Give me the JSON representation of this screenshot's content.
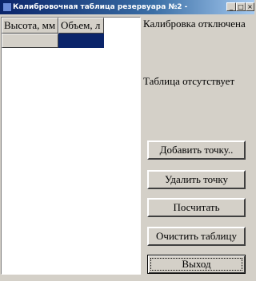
{
  "window": {
    "title": "Калибровочная таблица резервуара №2 -",
    "controls": {
      "minimize": "_",
      "maximize": "□",
      "close": "×"
    }
  },
  "grid": {
    "columns": [
      "Высота, мм",
      "Объем, л"
    ],
    "rows": [
      [
        "",
        ""
      ]
    ],
    "selected_color": "#0a246a"
  },
  "status": {
    "calibration": "Калибровка отключена",
    "table": "Таблица отсутствует"
  },
  "buttons": {
    "add_point": "Добавить точку..",
    "delete_point": "Удалить точку",
    "calculate": "Посчитать",
    "clear_table": "Очистить таблицу",
    "exit": "Выход"
  }
}
